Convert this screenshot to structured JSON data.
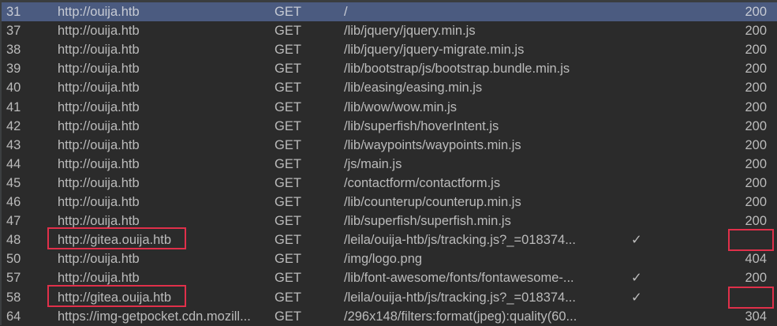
{
  "rows": [
    {
      "num": "31",
      "host": "http://ouija.htb",
      "method": "GET",
      "url": "/",
      "param": "",
      "status": "200",
      "selected": true
    },
    {
      "num": "37",
      "host": "http://ouija.htb",
      "method": "GET",
      "url": "/lib/jquery/jquery.min.js",
      "param": "",
      "status": "200"
    },
    {
      "num": "38",
      "host": "http://ouija.htb",
      "method": "GET",
      "url": "/lib/jquery/jquery-migrate.min.js",
      "param": "",
      "status": "200"
    },
    {
      "num": "39",
      "host": "http://ouija.htb",
      "method": "GET",
      "url": "/lib/bootstrap/js/bootstrap.bundle.min.js",
      "param": "",
      "status": "200"
    },
    {
      "num": "40",
      "host": "http://ouija.htb",
      "method": "GET",
      "url": "/lib/easing/easing.min.js",
      "param": "",
      "status": "200"
    },
    {
      "num": "41",
      "host": "http://ouija.htb",
      "method": "GET",
      "url": "/lib/wow/wow.min.js",
      "param": "",
      "status": "200"
    },
    {
      "num": "42",
      "host": "http://ouija.htb",
      "method": "GET",
      "url": "/lib/superfish/hoverIntent.js",
      "param": "",
      "status": "200"
    },
    {
      "num": "43",
      "host": "http://ouija.htb",
      "method": "GET",
      "url": "/lib/waypoints/waypoints.min.js",
      "param": "",
      "status": "200"
    },
    {
      "num": "44",
      "host": "http://ouija.htb",
      "method": "GET",
      "url": "/js/main.js",
      "param": "",
      "status": "200"
    },
    {
      "num": "45",
      "host": "http://ouija.htb",
      "method": "GET",
      "url": "/contactform/contactform.js",
      "param": "",
      "status": "200"
    },
    {
      "num": "46",
      "host": "http://ouija.htb",
      "method": "GET",
      "url": "/lib/counterup/counterup.min.js",
      "param": "",
      "status": "200"
    },
    {
      "num": "47",
      "host": "http://ouija.htb",
      "method": "GET",
      "url": "/lib/superfish/superfish.min.js",
      "param": "",
      "status": "200"
    },
    {
      "num": "48",
      "host": "http://gitea.ouija.htb",
      "method": "GET",
      "url": "/leila/ouija-htb/js/tracking.js?_=018374...",
      "param": "✓",
      "status": "",
      "highlight": true
    },
    {
      "num": "50",
      "host": "http://ouija.htb",
      "method": "GET",
      "url": "/img/logo.png",
      "param": "",
      "status": "404"
    },
    {
      "num": "57",
      "host": "http://ouija.htb",
      "method": "GET",
      "url": "/lib/font-awesome/fonts/fontawesome-...",
      "param": "✓",
      "status": "200"
    },
    {
      "num": "58",
      "host": "http://gitea.ouija.htb",
      "method": "GET",
      "url": "/leila/ouija-htb/js/tracking.js?_=018374...",
      "param": "✓",
      "status": "",
      "highlight": true
    },
    {
      "num": "64",
      "host": "https://img-getpocket.cdn.mozill...",
      "method": "GET",
      "url": "/296x148/filters:format(jpeg):quality(60...",
      "param": "",
      "status": "304"
    }
  ],
  "colors": {
    "background": "#2b2b2b",
    "selected_row": "#4b5b80",
    "text": "#bbbbbb",
    "highlight_box": "#e0304a"
  }
}
